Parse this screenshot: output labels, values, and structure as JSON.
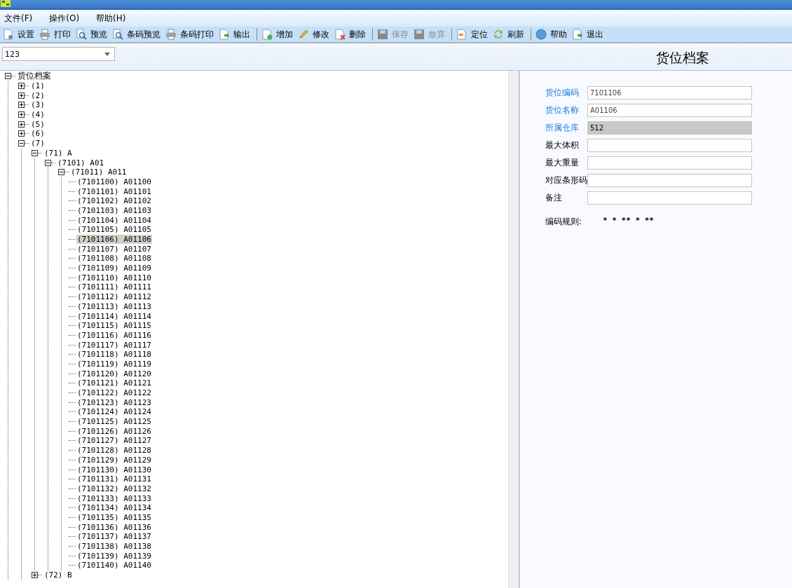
{
  "menu": [
    {
      "label": "文件(F)"
    },
    {
      "label": "操作(O)"
    },
    {
      "label": "帮助(H)"
    }
  ],
  "toolbar": [
    [
      {
        "label": "设置",
        "disabled": false
      },
      {
        "label": "打印",
        "disabled": false
      },
      {
        "label": "预览",
        "disabled": false
      },
      {
        "label": "条码预览",
        "disabled": false
      },
      {
        "label": "条码打印",
        "disabled": false
      },
      {
        "label": "输出",
        "disabled": false
      }
    ],
    [
      {
        "label": "增加",
        "disabled": false
      },
      {
        "label": "修改",
        "disabled": false
      },
      {
        "label": "删除",
        "disabled": false
      }
    ],
    [
      {
        "label": "保存",
        "disabled": true
      },
      {
        "label": "放弃",
        "disabled": true
      }
    ],
    [
      {
        "label": "定位",
        "disabled": false
      },
      {
        "label": "刷新",
        "disabled": false
      }
    ],
    [
      {
        "label": "帮助",
        "disabled": false
      },
      {
        "label": "退出",
        "disabled": false
      }
    ]
  ],
  "combo": {
    "value": "123"
  },
  "page_title": "货位档案",
  "tree": {
    "label": "货位档案",
    "expanded": true,
    "selected": false,
    "children": [
      {
        "label": "(1)",
        "expanded": false,
        "selected": false
      },
      {
        "label": "(2)",
        "expanded": false,
        "selected": false
      },
      {
        "label": "(3)",
        "expanded": false,
        "selected": false
      },
      {
        "label": "(4)",
        "expanded": false,
        "selected": false
      },
      {
        "label": "(5)",
        "expanded": false,
        "selected": false
      },
      {
        "label": "(6)",
        "expanded": false,
        "selected": false
      },
      {
        "label": "(7)",
        "expanded": true,
        "selected": false,
        "children": [
          {
            "label": "(71) A",
            "expanded": true,
            "selected": false,
            "children": [
              {
                "label": "(7101) A01",
                "expanded": true,
                "selected": false,
                "children": [
                  {
                    "label": "(71011) A011",
                    "expanded": true,
                    "selected": false,
                    "children": [
                      {
                        "label": "(7101100) A01100",
                        "selected": false
                      },
                      {
                        "label": "(7101101) A01101",
                        "selected": false
                      },
                      {
                        "label": "(7101102) A01102",
                        "selected": false
                      },
                      {
                        "label": "(7101103) A01103",
                        "selected": false
                      },
                      {
                        "label": "(7101104) A01104",
                        "selected": false
                      },
                      {
                        "label": "(7101105) A01105",
                        "selected": false
                      },
                      {
                        "label": "(7101106) A01106",
                        "selected": true
                      },
                      {
                        "label": "(7101107) A01107",
                        "selected": false
                      },
                      {
                        "label": "(7101108) A01108",
                        "selected": false
                      },
                      {
                        "label": "(7101109) A01109",
                        "selected": false
                      },
                      {
                        "label": "(7101110) A01110",
                        "selected": false
                      },
                      {
                        "label": "(7101111) A01111",
                        "selected": false
                      },
                      {
                        "label": "(7101112) A01112",
                        "selected": false
                      },
                      {
                        "label": "(7101113) A01113",
                        "selected": false
                      },
                      {
                        "label": "(7101114) A01114",
                        "selected": false
                      },
                      {
                        "label": "(7101115) A01115",
                        "selected": false
                      },
                      {
                        "label": "(7101116) A01116",
                        "selected": false
                      },
                      {
                        "label": "(7101117) A01117",
                        "selected": false
                      },
                      {
                        "label": "(7101118) A01118",
                        "selected": false
                      },
                      {
                        "label": "(7101119) A01119",
                        "selected": false
                      },
                      {
                        "label": "(7101120) A01120",
                        "selected": false
                      },
                      {
                        "label": "(7101121) A01121",
                        "selected": false
                      },
                      {
                        "label": "(7101122) A01122",
                        "selected": false
                      },
                      {
                        "label": "(7101123) A01123",
                        "selected": false
                      },
                      {
                        "label": "(7101124) A01124",
                        "selected": false
                      },
                      {
                        "label": "(7101125) A01125",
                        "selected": false
                      },
                      {
                        "label": "(7101126) A01126",
                        "selected": false
                      },
                      {
                        "label": "(7101127) A01127",
                        "selected": false
                      },
                      {
                        "label": "(7101128) A01128",
                        "selected": false
                      },
                      {
                        "label": "(7101129) A01129",
                        "selected": false
                      },
                      {
                        "label": "(7101130) A01130",
                        "selected": false
                      },
                      {
                        "label": "(7101131) A01131",
                        "selected": false
                      },
                      {
                        "label": "(7101132) A01132",
                        "selected": false
                      },
                      {
                        "label": "(7101133) A01133",
                        "selected": false
                      },
                      {
                        "label": "(7101134) A01134",
                        "selected": false
                      },
                      {
                        "label": "(7101135) A01135",
                        "selected": false
                      },
                      {
                        "label": "(7101136) A01136",
                        "selected": false
                      },
                      {
                        "label": "(7101137) A01137",
                        "selected": false
                      },
                      {
                        "label": "(7101138) A01138",
                        "selected": false
                      },
                      {
                        "label": "(7101139) A01139",
                        "selected": false
                      },
                      {
                        "label": "(7101140) A01140",
                        "selected": false
                      }
                    ]
                  }
                ]
              }
            ]
          },
          {
            "label": "(72) B",
            "expanded": false,
            "selected": false
          }
        ]
      }
    ]
  },
  "form": [
    {
      "label": "货位编码",
      "highlighted": true,
      "value": "7101106",
      "disabled": false
    },
    {
      "label": "货位名称",
      "highlighted": true,
      "value": "A01106",
      "disabled": false
    },
    {
      "label": "所属仓库",
      "highlighted": true,
      "value": "512",
      "disabled": true
    },
    {
      "label": "最大体积",
      "highlighted": false,
      "disabled": false
    },
    {
      "label": "最大重量",
      "highlighted": false,
      "disabled": false
    },
    {
      "label": "对应条形码",
      "highlighted": false,
      "disabled": false
    },
    {
      "label": "备注",
      "highlighted": false,
      "disabled": false
    }
  ],
  "code_rule": {
    "label": "编码规则:",
    "value": "* * ** * **"
  }
}
